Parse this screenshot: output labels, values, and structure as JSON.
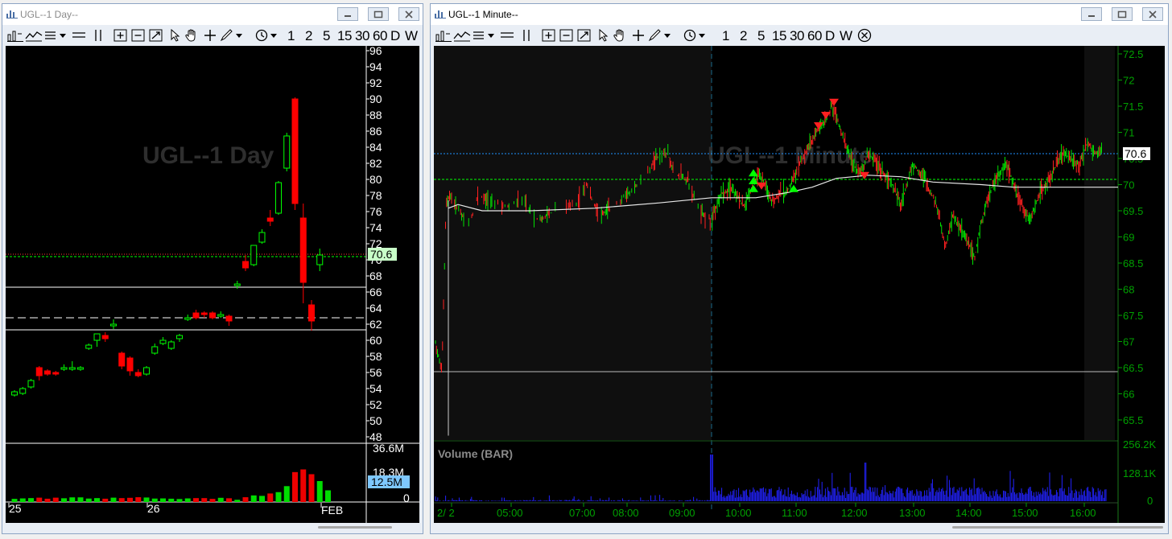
{
  "windows": [
    {
      "title": "UGL--1 Day--",
      "watermark": "UGL--1 Day",
      "price_label": "70.6",
      "volume_label": "12.5M",
      "y_ticks": [
        "96",
        "94",
        "92",
        "90",
        "88",
        "86",
        "84",
        "82",
        "80",
        "78",
        "76",
        "74",
        "72",
        "70",
        "68",
        "66",
        "64",
        "62",
        "60",
        "58",
        "56",
        "54",
        "52",
        "50",
        "48"
      ],
      "vol_ticks": [
        "36.6M",
        "18.3M",
        "0"
      ],
      "x_ticks": [
        "25",
        "26",
        "FEB"
      ]
    },
    {
      "title": "UGL--1 Minute--",
      "watermark": "UGL--1 Minute",
      "price_label": "70.6",
      "panel_label": "Volume (BAR)",
      "y_ticks": [
        "72.5",
        "72",
        "71.5",
        "71",
        "70.5",
        "70",
        "69.5",
        "69",
        "68.5",
        "68",
        "67.5",
        "67",
        "66.5",
        "66",
        "65.5"
      ],
      "vol_ticks": [
        "256.2K",
        "128.1K",
        "0"
      ],
      "x_ticks": [
        "2/ 2",
        "05:00",
        "07:00",
        "08:00",
        "09:00",
        "10:00",
        "11:00",
        "12:00",
        "13:00",
        "14:00",
        "15:00",
        "16:00"
      ]
    }
  ],
  "toolbar": {
    "timeframes": [
      "1",
      "2",
      "5",
      "15",
      "30",
      "60",
      "D",
      "W"
    ]
  },
  "icons": [
    "chart-window-icon",
    "minimize-icon",
    "maximize-icon",
    "close-icon",
    "bar-chart-icon",
    "line-style-icon",
    "study-menu-icon",
    "horizontal-line-icon",
    "vertical-line-icon",
    "zoom-in-icon",
    "zoom-out-icon",
    "zoom-reset-icon",
    "cursor-icon",
    "pan-icon",
    "crosshair-icon",
    "pencil-icon",
    "clock-icon",
    "close-circle-icon"
  ],
  "colors": {
    "up": "#00ff00",
    "down": "#ff0000",
    "axis_green": "#00a000",
    "volume_bar": "#2222ff",
    "price_line": "#00ff00",
    "blue_dotted": "#1e90ff"
  }
}
